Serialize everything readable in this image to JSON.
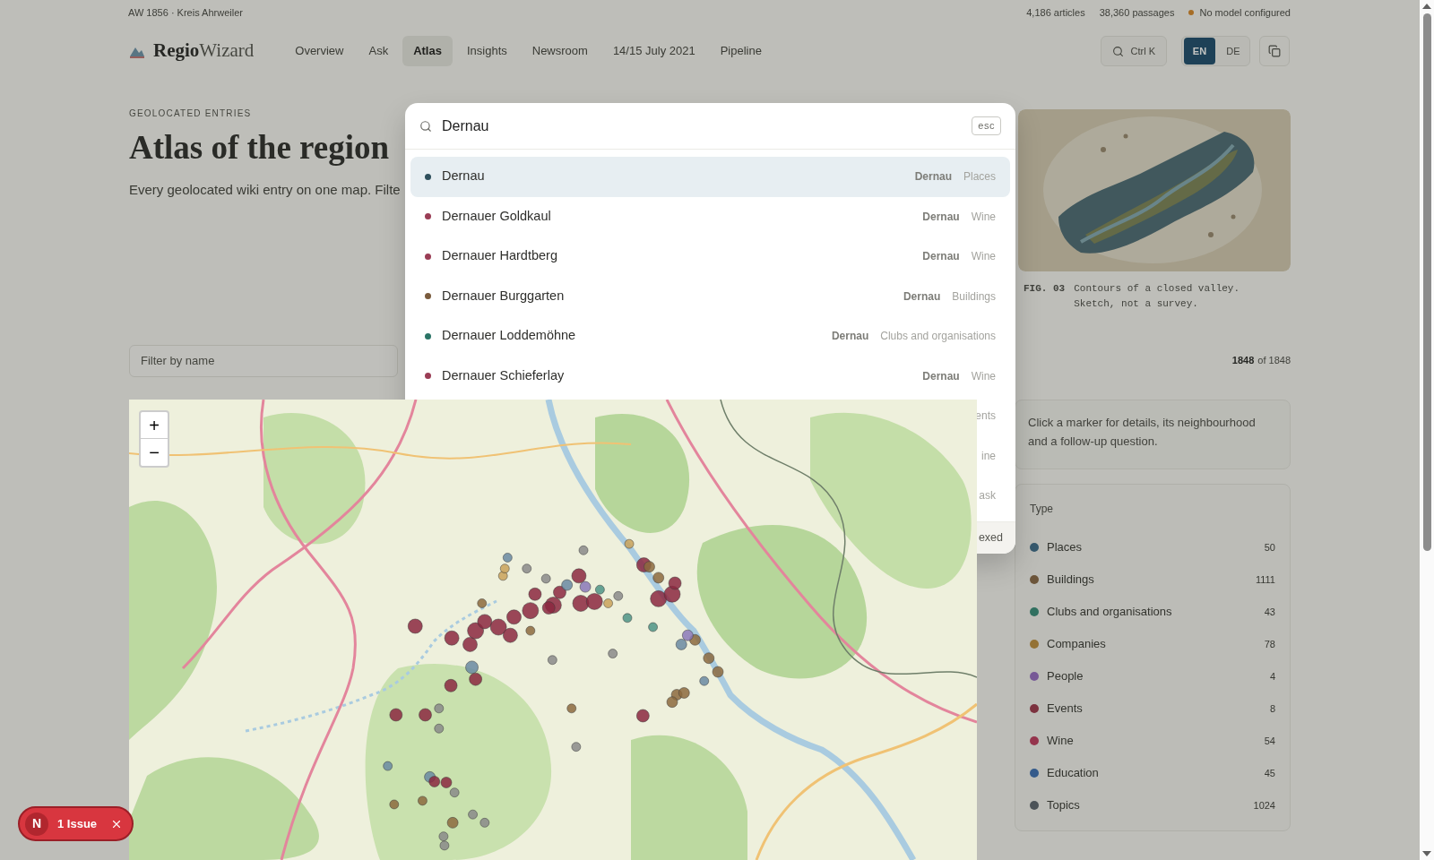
{
  "top_strip": {
    "location": "AW 1856 · Kreis Ahrweiler",
    "stats": [
      "4,186 articles",
      "38,360 passages"
    ],
    "model_status": "No model configured"
  },
  "nav": {
    "brand": {
      "strong": "Regio",
      "light": "Wizard"
    },
    "items": [
      {
        "label": "Overview",
        "selected": false
      },
      {
        "label": "Ask",
        "selected": false
      },
      {
        "label": "Atlas",
        "selected": true
      },
      {
        "label": "Insights",
        "selected": false
      },
      {
        "label": "Newsroom",
        "selected": false
      },
      {
        "label": "14/15 July 2021",
        "selected": false
      },
      {
        "label": "Pipeline",
        "selected": false
      }
    ],
    "search": {
      "shortcut": "Ctrl K"
    },
    "languages": [
      {
        "label": "EN",
        "selected": true
      },
      {
        "label": "DE",
        "selected": false
      }
    ]
  },
  "header": {
    "eyebrow": "GEOLOCATED ENTRIES",
    "title": "Atlas of the region",
    "subtitle": "Every geolocated wiki entry on one map. Filte"
  },
  "figure": {
    "label": "FIG. 03",
    "caption": "Contours of a closed valley. Sketch, not a survey."
  },
  "filter": {
    "placeholder": "Filter by name",
    "shown": "1848",
    "total": "of 1848"
  },
  "map": {
    "zoom_in": "+",
    "zoom_out": "−"
  },
  "info_card": {
    "text": "Click a marker for details, its neighbourhood and a follow-up question."
  },
  "types": {
    "title": "Type",
    "items": [
      {
        "label": "Places",
        "count": "50",
        "color": "#36596e"
      },
      {
        "label": "Buildings",
        "count": "1111",
        "color": "#6d553a"
      },
      {
        "label": "Clubs and organisations",
        "count": "43",
        "color": "#327060"
      },
      {
        "label": "Companies",
        "count": "78",
        "color": "#947235"
      },
      {
        "label": "People",
        "count": "4",
        "color": "#785997"
      },
      {
        "label": "Events",
        "count": "8",
        "color": "#7d323f"
      },
      {
        "label": "Wine",
        "count": "54",
        "color": "#96344d"
      },
      {
        "label": "Education",
        "count": "45",
        "color": "#355b8b"
      },
      {
        "label": "Topics",
        "count": "1024",
        "color": "#4d5358"
      }
    ]
  },
  "command_palette": {
    "query": "Dernau",
    "dismiss_key": "esc",
    "results": [
      {
        "title": "Dernau",
        "place": "Dernau",
        "category": "Places",
        "color": "#2e4f5c",
        "selected": true
      },
      {
        "title": "Dernauer Goldkaul",
        "place": "Dernau",
        "category": "Wine",
        "color": "#9a3d55",
        "selected": false
      },
      {
        "title": "Dernauer Hardtberg",
        "place": "Dernau",
        "category": "Wine",
        "color": "#9a3d55",
        "selected": false
      },
      {
        "title": "Dernauer Burggarten",
        "place": "Dernau",
        "category": "Buildings",
        "color": "#7a5b3d",
        "selected": false
      },
      {
        "title": "Dernauer Loddemöhne",
        "place": "Dernau",
        "category": "Clubs and organisations",
        "color": "#2b7466",
        "selected": false
      },
      {
        "title": "Dernauer Schieferlay",
        "place": "Dernau",
        "category": "Wine",
        "color": "#9a3d55",
        "selected": false
      }
    ],
    "covered_results": [
      {
        "visible_text": "ents"
      },
      {
        "visible_text": "ine"
      },
      {
        "visible_text": "ask"
      }
    ],
    "footer": {
      "visible_text": "exed"
    }
  },
  "dev_indicator": {
    "logo": "N",
    "label": "1 Issue"
  }
}
